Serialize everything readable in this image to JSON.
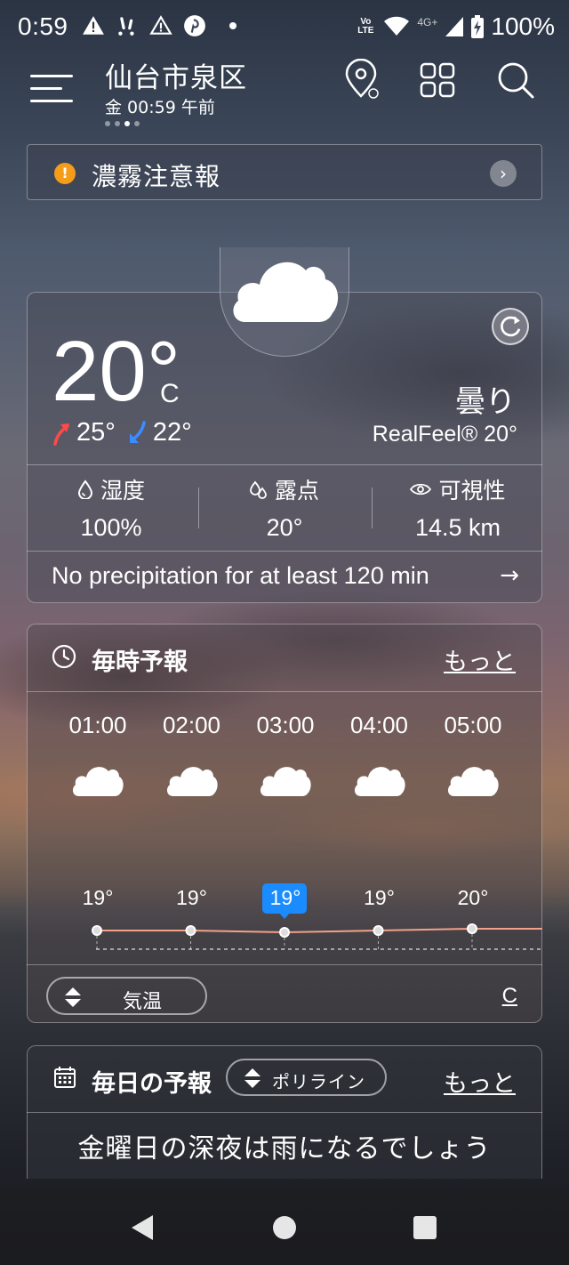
{
  "status_bar": {
    "time": "0:59",
    "network_label": "Vo LTE",
    "network_top": "Vo",
    "network_bottom": "LTE",
    "network_gen": "4G+",
    "battery": "100%"
  },
  "header": {
    "location": "仙台市泉区",
    "local_time": "金 00:59 午前",
    "page_count": 4,
    "active_page": 3
  },
  "alert": {
    "text": "濃霧注意報"
  },
  "current": {
    "temperature": "20°",
    "unit": "C",
    "high": "25°",
    "low": "22°",
    "condition": "曇り",
    "realfeel": "RealFeel® 20°",
    "stats": [
      {
        "label": "湿度",
        "value": "100%",
        "icon": "humidity-drop-icon"
      },
      {
        "label": "露点",
        "value": "20°",
        "icon": "dew-point-icon"
      },
      {
        "label": "可視性",
        "value": "14.5 km",
        "icon": "eye-icon"
      }
    ],
    "precipitation": "No precipitation for at least 120 min"
  },
  "hourly": {
    "title": "毎時予報",
    "more": "もっと",
    "hours": [
      {
        "time": "01:00",
        "temp": "19°",
        "icon": "cloud-icon"
      },
      {
        "time": "02:00",
        "temp": "19°",
        "icon": "cloud-icon"
      },
      {
        "time": "03:00",
        "temp": "19°",
        "icon": "cloud-icon",
        "selected": true
      },
      {
        "time": "04:00",
        "temp": "19°",
        "icon": "cloud-icon"
      },
      {
        "time": "05:00",
        "temp": "20°",
        "icon": "cloud-icon"
      }
    ],
    "metric_toggle": "気温",
    "unit": "C"
  },
  "daily": {
    "title": "毎日の予報",
    "style_toggle": "ポリライン",
    "more": "もっと",
    "summary": "金曜日の深夜は雨になるでしょう"
  },
  "colors": {
    "alert": "#f59d1b",
    "selected": "#1a8cff",
    "high_arrow": "#ff4a4a",
    "low_arrow": "#3c8cff",
    "temp_line": "#f2a089"
  }
}
